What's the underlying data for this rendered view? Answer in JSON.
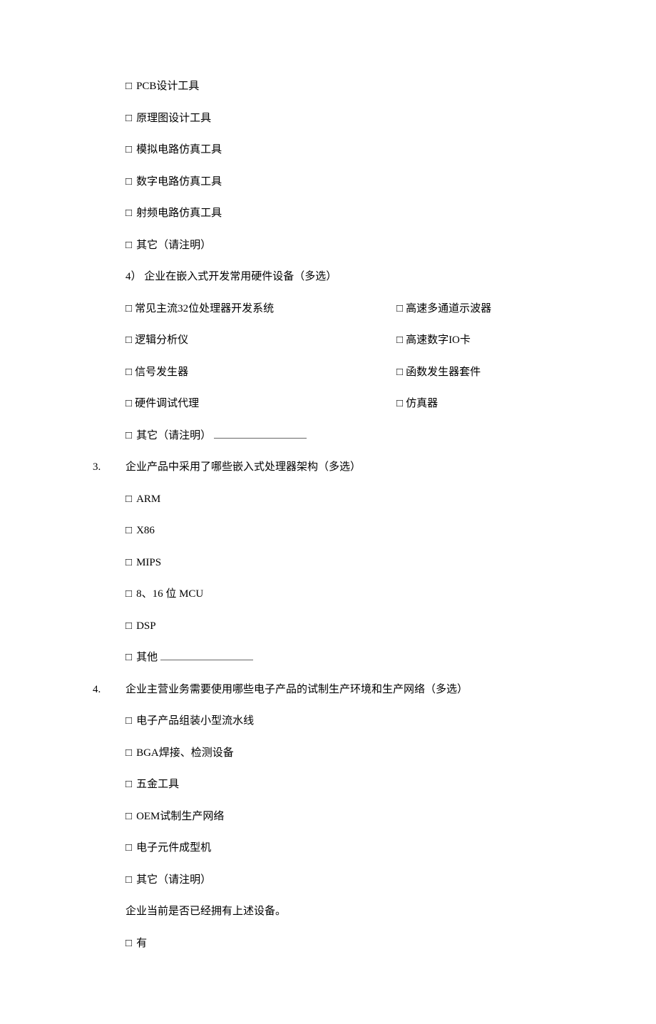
{
  "q2_sub_intro_opts": [
    "PCB设计工具",
    "原理图设计工具",
    "模拟电路仿真工具",
    "数字电路仿真工具",
    "射频电路仿真工具",
    "其它（请注明）"
  ],
  "q2_sub4_label": "4）  企业在嵌入式开发常用硬件设备（多选）",
  "q2_sub4_rows": [
    {
      "l": "常见主流32位处理器开发系统",
      "r": "高速多通道示波器"
    },
    {
      "l": "逻辑分析仪",
      "r": "高速数字IO卡"
    },
    {
      "l": "信号发生器",
      "r": "函数发生器套件"
    },
    {
      "l": "硬件调试代理",
      "r": "仿真器"
    }
  ],
  "q2_sub4_other": "其它（请注明）",
  "q3_num": "3.",
  "q3_text": "企业产品中采用了哪些嵌入式处理器架构（多选）",
  "q3_opts": [
    "ARM",
    "X86",
    "MIPS",
    "8、16 位 MCU",
    "DSP"
  ],
  "q3_other": "其他",
  "q4_num": "4.",
  "q4_text": "企业主营业务需要使用哪些电子产品的试制生产环境和生产网络（多选）",
  "q4_opts": [
    "电子产品组装小型流水线",
    "BGA焊接、检测设备",
    "五金工具",
    "OEM试制生产网络",
    "电子元件成型机",
    "其它（请注明）"
  ],
  "q4_follow": "企业当前是否已经拥有上述设备。",
  "q4_follow_opt": "有",
  "checkbox_glyph": "□"
}
